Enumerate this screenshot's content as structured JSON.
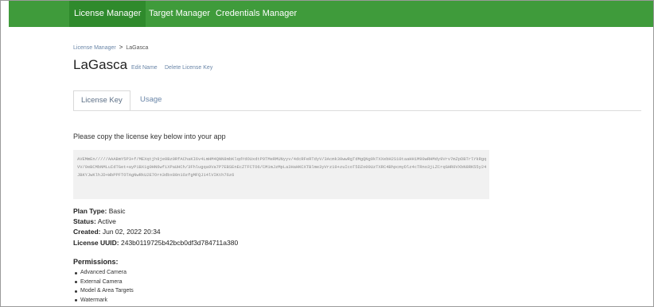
{
  "nav": {
    "items": [
      "License Manager",
      "Target Manager",
      "Credentials Manager"
    ]
  },
  "breadcrumb": {
    "parent": "License Manager",
    "separator": ">",
    "current": "LaGasca"
  },
  "page": {
    "title": "LaGasca",
    "edit_name": "Edit Name",
    "delete_key": "Delete License Key"
  },
  "tabs": [
    "License Key",
    "Usage"
  ],
  "instructions": "Please copy the license key below into your app",
  "license_key": "AVEMmEn/////AAABmY5P3+f/MEXqtjh9je0Bz0RfAChaKI6v4LmHM4QNN8mbKlqdYdOUxdtP9TMeRMUNyyv/4dcRFeRTdyV/3Acmk30wwRgTdMgQNg9kTXXebH2S10taaHH1M90wRHMdy9Vrv7mZpDBTrlYkRgqVV/0eBCMbNMLuIdTGet+ayP1BX1g0HN6wfiXPaUHCh/3Fhlugqa9Va7P7EBSEnEcZTFCTO6/CM1mJzMpLa3HaHKCXTBlme3yVrz10+zuIcoT5DZo00UzTXRC4BhpcmyDlz4cTRno3jLZCrqGHR0VXbN8RK55y24JBKYJwKlhJD+WbPPFTOTAgNwRkU2E7Orn3dbx80n1OzfgMFQJ14lVIKth76z6",
  "info": {
    "plan_type": {
      "label": "Plan Type:",
      "value": "Basic"
    },
    "status": {
      "label": "Status:",
      "value": "Active"
    },
    "created": {
      "label": "Created:",
      "value": "Jun 02, 2022 20:34"
    },
    "uuid": {
      "label": "License UUID:",
      "value": "243b0119725b42bcb0df3d784711a380"
    }
  },
  "permissions": {
    "title": "Permissions:",
    "items": [
      "Advanced Camera",
      "External Camera",
      "Model & Area Targets",
      "Watermark"
    ]
  },
  "colors": {
    "nav_bg": "#3f9b3b",
    "nav_active": "#2f8a2c",
    "link": "#6a86a8"
  }
}
